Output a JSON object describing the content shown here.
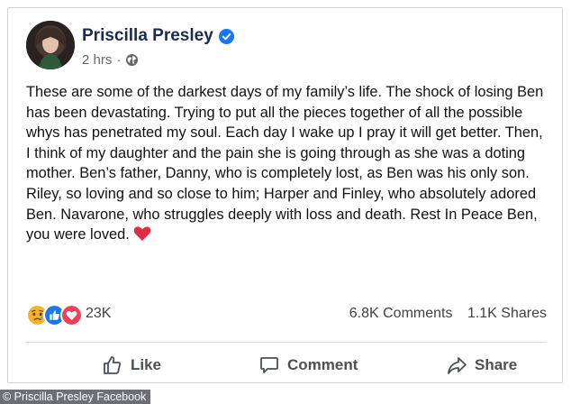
{
  "post": {
    "author": "Priscilla Presley",
    "timestamp": "2 hrs",
    "verified_icon": "verified-badge-icon",
    "privacy_icon": "globe-icon",
    "text": "These are some of the darkest days of my family’s life. The shock of losing Ben has been devastating. Trying to put all the pieces together of all the possible whys has penetrated my soul. Each day I wake up I pray it will get better. Then, I think of my daughter and the pain she is going through as she was a doting mother. Ben’s father, Danny, who is completely lost, as Ben was his only son. Riley, so loving and so close to him; Harper and Finley, who absolutely adored Ben. Navarone, who struggles deeply with loss and death. Rest In Peace Ben, you were loved.",
    "text_emoji": "red-heart-icon"
  },
  "reactions": {
    "icons": [
      "sad-reaction-icon",
      "like-reaction-icon",
      "love-reaction-icon"
    ],
    "count": "23K",
    "comments": "6.8K Comments",
    "shares": "1.1K Shares"
  },
  "actions": {
    "like": "Like",
    "comment": "Comment",
    "share": "Share"
  },
  "credit": "© Priscilla Presley Facebook",
  "colors": {
    "facebook_blue": "#1877f2",
    "love_red": "#f33e58",
    "sad_yellow": "#f7b125"
  }
}
